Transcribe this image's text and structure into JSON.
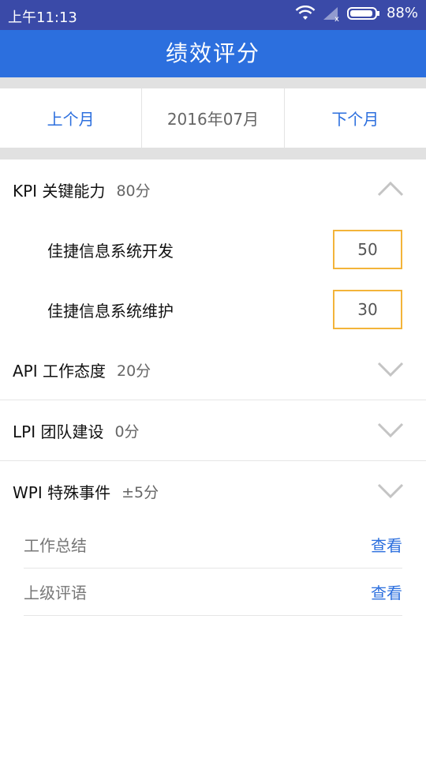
{
  "status": {
    "time": "上午11:13",
    "battery": "88%"
  },
  "appbar": {
    "title": "绩效评分"
  },
  "month_nav": {
    "prev": "上个月",
    "current": "2016年07月",
    "next": "下个月"
  },
  "sections": [
    {
      "name": "KPI 关键能力",
      "score": "80分",
      "expanded": true,
      "items": [
        {
          "label": "佳捷信息系统开发",
          "value": "50"
        },
        {
          "label": "佳捷信息系统维护",
          "value": "30"
        }
      ]
    },
    {
      "name": "API 工作态度",
      "score": "20分",
      "expanded": false
    },
    {
      "name": "LPI 团队建设",
      "score": "0分",
      "expanded": false
    },
    {
      "name": "WPI 特殊事件",
      "score": "±5分",
      "expanded": false,
      "links": [
        {
          "label": "工作总结",
          "action": "查看"
        },
        {
          "label": "上级评语",
          "action": "查看"
        }
      ]
    }
  ],
  "colors": {
    "statusbar": "#3a4aa8",
    "appbar": "#2c6fde",
    "accent": "#2c6fde",
    "input_border": "#f3b43a"
  },
  "icons": {
    "expanded": "chevron-up-icon",
    "collapsed": "chevron-down-icon"
  }
}
